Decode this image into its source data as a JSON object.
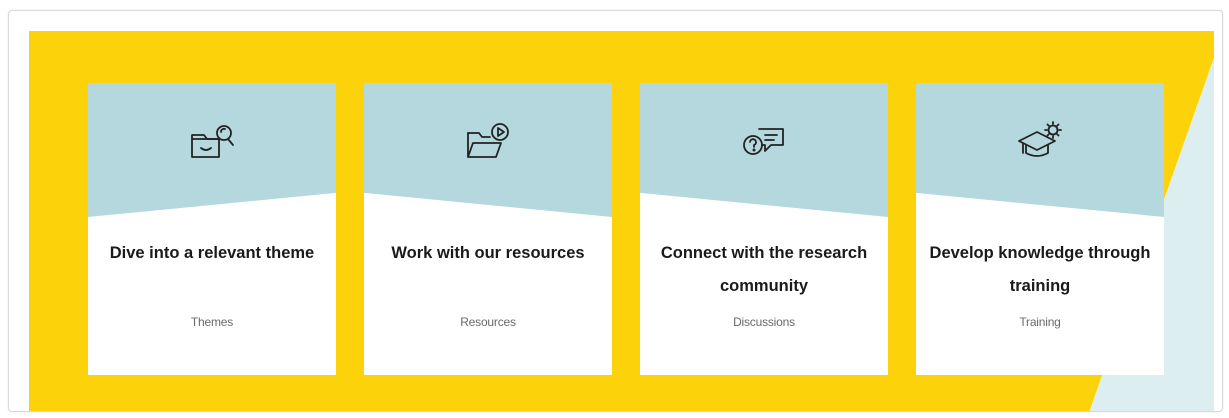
{
  "cards": [
    {
      "title": "Dive into a relevant theme",
      "link": "Themes",
      "icon": "folder-search-icon"
    },
    {
      "title": "Work with our resources",
      "link": "Resources",
      "icon": "folder-play-icon"
    },
    {
      "title": "Connect with the research community",
      "link": "Discussions",
      "icon": "question-chat-icon"
    },
    {
      "title": "Develop knowledge through training",
      "link": "Training",
      "icon": "graduation-cap-icon"
    }
  ],
  "colors": {
    "band_yellow": "#fcd30a",
    "card_header_blue": "#b5d8df",
    "corner_light_blue": "#ddeef1",
    "card_background": "#ffffff",
    "title_text": "#1a1a1a",
    "link_text": "#6a6a6a"
  }
}
